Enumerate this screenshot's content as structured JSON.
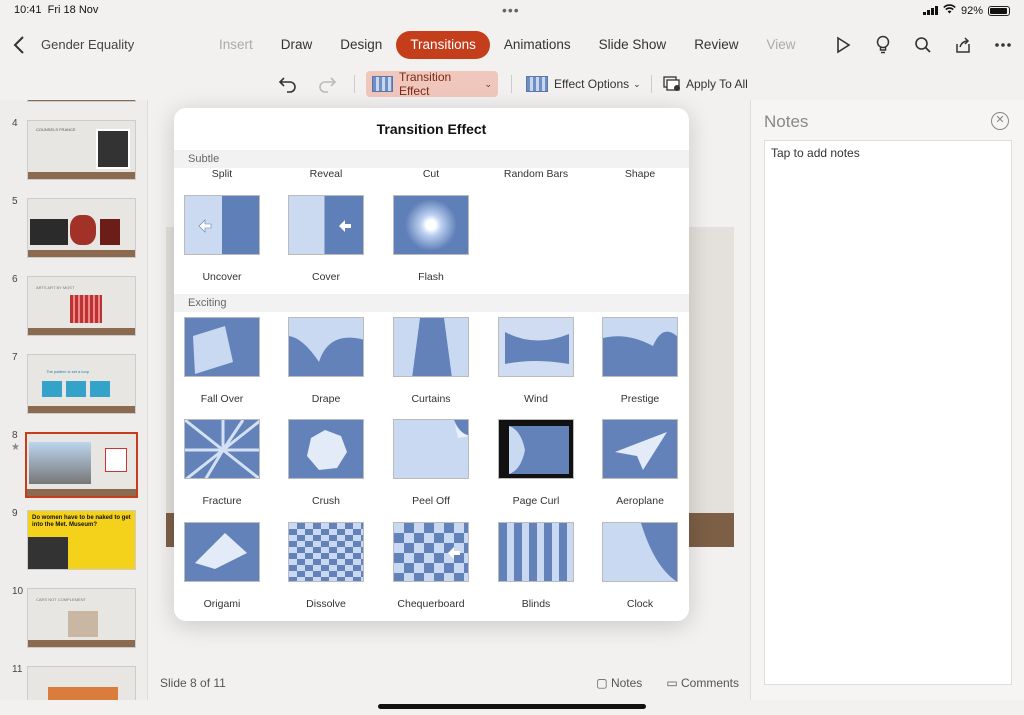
{
  "status": {
    "time": "10:41",
    "date": "Fri 18 Nov",
    "battery": "92%",
    "battery_level": 0.92
  },
  "header": {
    "doc_title": "Gender Equality"
  },
  "tabs": [
    "Insert",
    "Draw",
    "Design",
    "Transitions",
    "Animations",
    "Slide Show",
    "Review",
    "View"
  ],
  "ribbon": {
    "transition_effect": "Transition Effect",
    "effect_options": "Effect Options",
    "apply_to_all": "Apply To All"
  },
  "thumbnails": [
    {
      "num": "4",
      "title": "COUNSELS FRANCE"
    },
    {
      "num": "5"
    },
    {
      "num": "6",
      "title": "ARTS ART BY MOST"
    },
    {
      "num": "7",
      "title": "The pattern is set a loop"
    },
    {
      "num": "8"
    },
    {
      "num": "9",
      "title": "Do women have to be naked to get into the Met. Museum?"
    },
    {
      "num": "10",
      "title": "CARS NOT COMPLEMENT"
    },
    {
      "num": "11"
    }
  ],
  "slide_status": "Slide 8 of 11",
  "bottom": {
    "notes": "Notes",
    "comments": "Comments"
  },
  "notes": {
    "title": "Notes",
    "placeholder": "Tap to add notes"
  },
  "popover": {
    "title": "Transition Effect",
    "subtle_head": "Subtle",
    "subtle_top_labels": [
      "Split",
      "Reveal",
      "Cut",
      "Random Bars",
      "Shape"
    ],
    "subtle": [
      "Uncover",
      "Cover",
      "Flash"
    ],
    "exciting_head": "Exciting",
    "exciting_row1": [
      "Fall Over",
      "Drape",
      "Curtains",
      "Wind",
      "Prestige"
    ],
    "exciting_row2": [
      "Fracture",
      "Crush",
      "Peel Off",
      "Page Curl",
      "Aeroplane"
    ],
    "exciting_row3": [
      "Origami",
      "Dissolve",
      "Chequerboard",
      "Blinds",
      "Clock"
    ]
  },
  "colors": {
    "accent": "#c43e1c",
    "tile_blue": "#6382ba"
  }
}
